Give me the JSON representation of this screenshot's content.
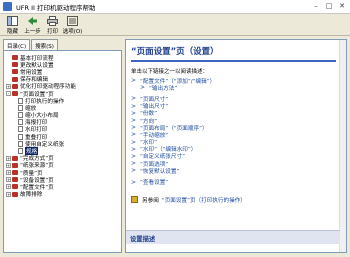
{
  "window": {
    "title": "UFR II 打印机驱动程序帮助"
  },
  "toolbar": {
    "buttons": [
      {
        "label": "隐藏"
      },
      {
        "label": "上一步"
      },
      {
        "label": "打印"
      },
      {
        "label": "选项(O)"
      }
    ]
  },
  "tabs": [
    {
      "label": "目录(C)"
    },
    {
      "label": "搜索(S)"
    }
  ],
  "tree": [
    {
      "label": "基本打印流程",
      "kind": "book",
      "expander": ""
    },
    {
      "label": "更改默认设置",
      "kind": "book",
      "expander": ""
    },
    {
      "label": "常用设置",
      "kind": "book",
      "expander": ""
    },
    {
      "label": "保存和编辑",
      "kind": "book",
      "expander": ""
    },
    {
      "label": "优化打印驱动程序功能",
      "kind": "book",
      "expander": "+"
    },
    {
      "label": "“页面设置”页",
      "kind": "book",
      "expander": "-"
    },
    {
      "label": "打印执行的操作",
      "kind": "page",
      "expander": ""
    },
    {
      "label": "缩放",
      "kind": "page",
      "expander": ""
    },
    {
      "label": "缩小大小布局",
      "kind": "page",
      "expander": ""
    },
    {
      "label": "海报打印",
      "kind": "page",
      "expander": ""
    },
    {
      "label": "水印打印",
      "kind": "page",
      "expander": ""
    },
    {
      "label": "重叠打印",
      "kind": "page",
      "expander": ""
    },
    {
      "label": "使用自定义纸张",
      "kind": "page",
      "expander": ""
    },
    {
      "label": "规格",
      "kind": "page",
      "expander": "",
      "selected": true
    },
    {
      "label": "“完成方式”页",
      "kind": "book",
      "expander": "+"
    },
    {
      "label": "“纸张来源”页",
      "kind": "book",
      "expander": "+"
    },
    {
      "label": "“质量”页",
      "kind": "book",
      "expander": "+"
    },
    {
      "label": "“设备设置”页",
      "kind": "book",
      "expander": "+"
    },
    {
      "label": "“配置文件”页",
      "kind": "book",
      "expander": "+"
    },
    {
      "label": "故障排除",
      "kind": "book",
      "expander": "+"
    }
  ],
  "content": {
    "heading": "“页面设置”页（设置）",
    "intro": "单击以下链接之一以阅读描述：",
    "links": [
      {
        "text": "“配置文件”（“添加”/“编辑”）",
        "sub": false,
        "gap": false
      },
      {
        "text": "“输出方法”",
        "sub": true,
        "gap": false
      },
      {
        "text": "“页面尺寸”",
        "sub": false,
        "gap": true
      },
      {
        "text": "“输出尺寸”",
        "sub": false,
        "gap": false
      },
      {
        "text": "“份数”",
        "sub": false,
        "gap": false
      },
      {
        "text": "“方向”",
        "sub": false,
        "gap": false
      },
      {
        "text": "“页面布局”（“页面顺序”）",
        "sub": false,
        "gap": false
      },
      {
        "text": "“手动缩放”",
        "sub": false,
        "gap": false
      },
      {
        "text": "“水印”",
        "sub": false,
        "gap": false
      },
      {
        "text": "“水印”（“编辑水印”）",
        "sub": false,
        "gap": false
      },
      {
        "text": "“自定义纸张尺寸”",
        "sub": false,
        "gap": false
      },
      {
        "text": "“页面选项”",
        "sub": false,
        "gap": false
      },
      {
        "text": "“恢复默认设置”",
        "sub": false,
        "gap": false
      },
      {
        "text": "“查看设置”",
        "sub": false,
        "gap": true
      }
    ],
    "see_also_prefix": "另参阅",
    "see_also_link": "“页面设置”页（打印执行的操作）",
    "desc_bar": "设置描述"
  }
}
